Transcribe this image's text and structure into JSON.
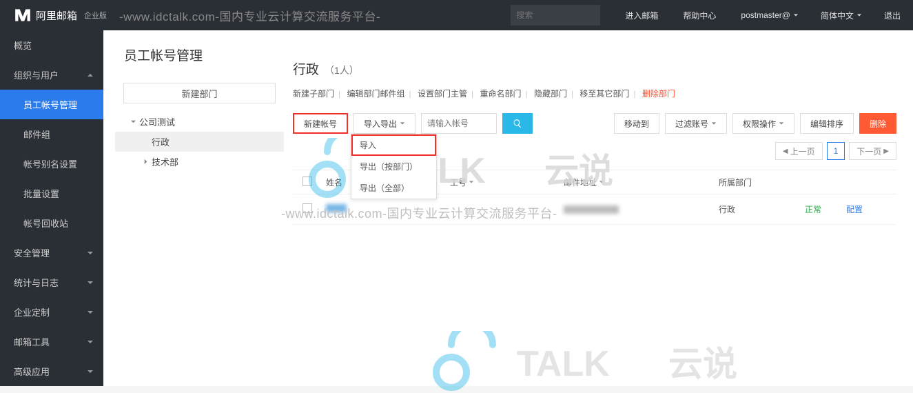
{
  "header": {
    "logo_text": "阿里邮箱",
    "logo_sub": "企业版",
    "watermark": "-www.idctalk.com-国内专业云计算交流服务平台-",
    "search_placeholder": "搜索",
    "enter_mail": "进入邮箱",
    "help": "帮助中心",
    "user": "postmaster@",
    "lang": "简体中文",
    "logout": "退出"
  },
  "sidebar": {
    "overview": "概览",
    "org": "组织与用户",
    "account_mgmt": "员工帐号管理",
    "mail_group": "邮件组",
    "alias": "帐号别名设置",
    "batch": "批量设置",
    "recycle": "帐号回收站",
    "security": "安全管理",
    "stats": "统计与日志",
    "custom": "企业定制",
    "tools": "邮箱工具",
    "advanced": "高级应用"
  },
  "page_title": "员工帐号管理",
  "tree": {
    "new_dept": "新建部门",
    "root": "公司测试",
    "node1": "行政",
    "node2": "技术部"
  },
  "dept": {
    "name": "行政",
    "count": "（1人）",
    "new_sub": "新建子部门",
    "edit_group": "编辑部门邮件组",
    "set_mgr": "设置部门主管",
    "rename": "重命名部门",
    "hide": "隐藏部门",
    "move": "移至其它部门",
    "delete": "删除部门"
  },
  "toolbar": {
    "new_acct": "新建帐号",
    "import_export": "导入导出",
    "search_placeholder": "请输入帐号",
    "move_to": "移动到",
    "filter": "过滤账号",
    "perm": "权限操作",
    "edit_sort": "编辑排序",
    "delete": "删除"
  },
  "dropdown": {
    "import": "导入",
    "export_dept": "导出（按部门）",
    "export_all": "导出（全部）"
  },
  "pagination": {
    "prev": "上一页",
    "page": "1",
    "next": "下一页"
  },
  "table": {
    "col_name": "姓名",
    "col_no": "工号",
    "col_mail": "邮件地址",
    "col_dept": "所属部门",
    "row_dept": "行政",
    "row_status": "正常",
    "row_action": "配置"
  },
  "wm_mid": "-www.idctalk.com-国内专业云计算交流服务平台-"
}
